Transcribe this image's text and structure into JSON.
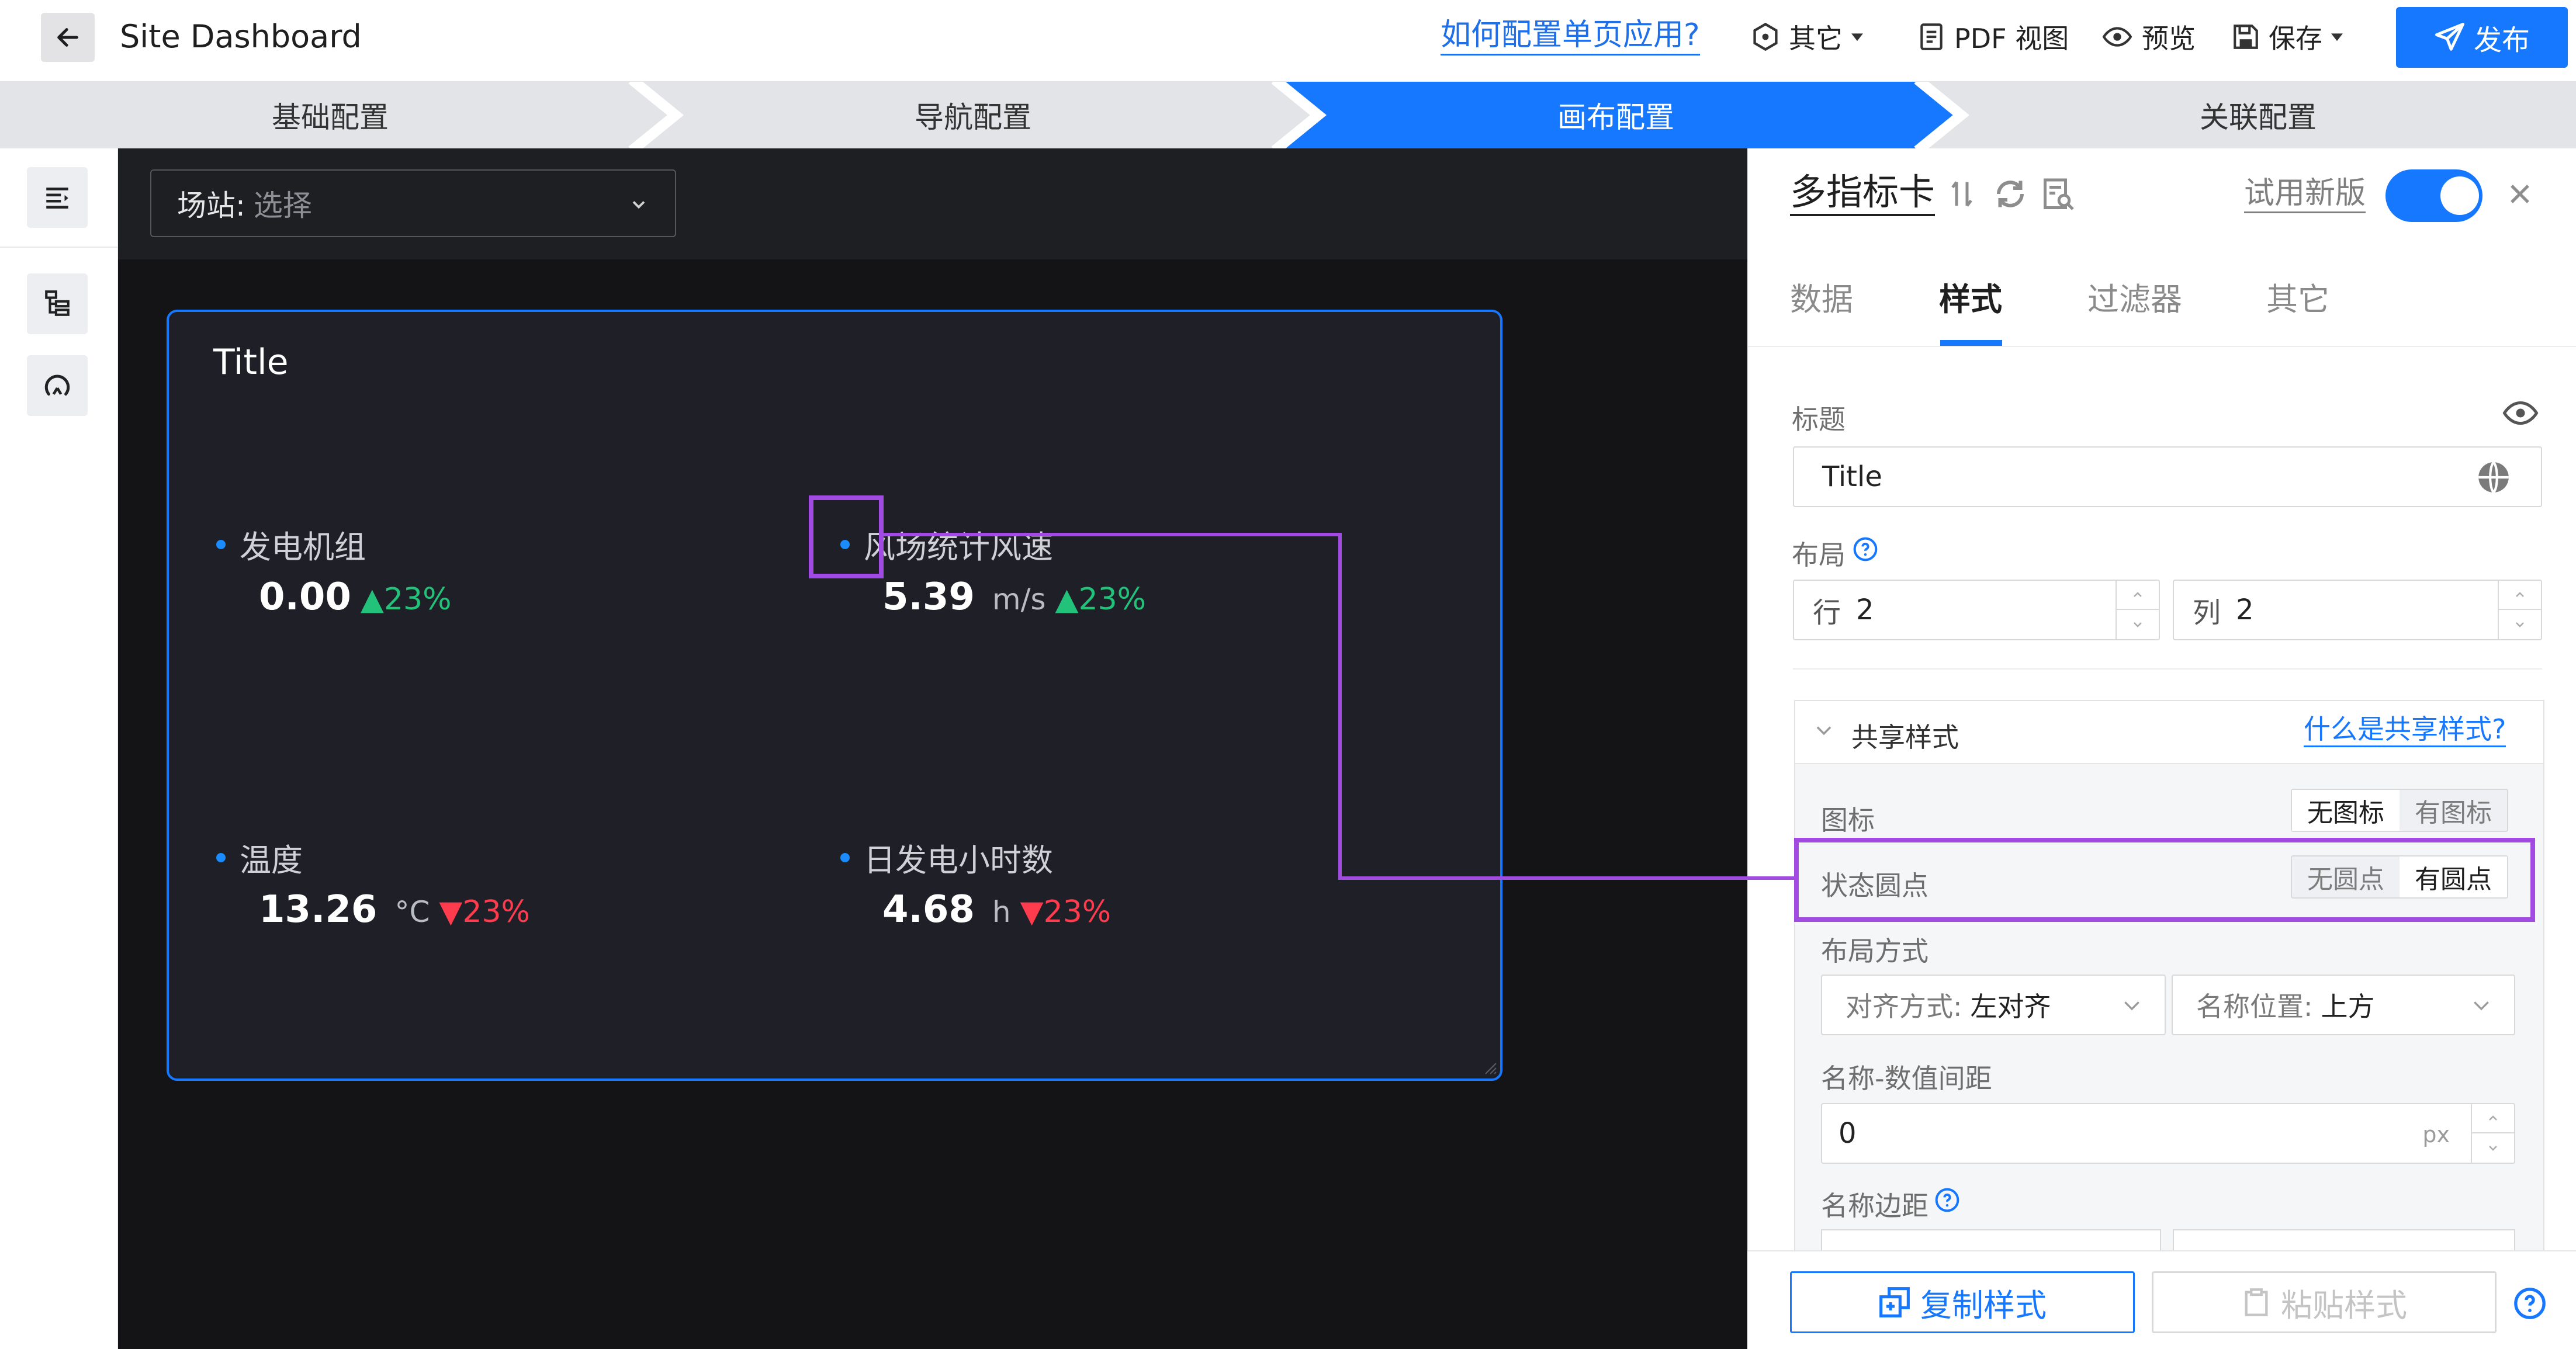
{
  "header": {
    "title": "Site Dashboard",
    "help_link": "如何配置单页应用?",
    "toolbar": {
      "other": "其它",
      "pdf_view": "PDF 视图",
      "preview": "预览",
      "save": "保存",
      "publish": "发布"
    }
  },
  "steps": [
    {
      "label": "基础配置",
      "active": false
    },
    {
      "label": "导航配置",
      "active": false
    },
    {
      "label": "画布配置",
      "active": true
    },
    {
      "label": "关联配置",
      "active": false
    }
  ],
  "canvas": {
    "site_select": {
      "label": "场站:",
      "placeholder": "选择"
    },
    "card": {
      "title": "Title",
      "metrics": [
        {
          "name": "发电机组",
          "value": "0.00",
          "unit": "",
          "trend": "up",
          "change": "23%"
        },
        {
          "name": "风场统计风速",
          "value": "5.39",
          "unit": "m/s",
          "trend": "up",
          "change": "23%"
        },
        {
          "name": "温度",
          "value": "13.26",
          "unit": "°C",
          "trend": "down",
          "change": "23%"
        },
        {
          "name": "日发电小时数",
          "value": "4.68",
          "unit": "h",
          "trend": "down",
          "change": "23%"
        }
      ]
    }
  },
  "panel": {
    "title": "多指标卡",
    "try_new": "试用新版",
    "toggle_on": true,
    "tabs": [
      {
        "label": "数据",
        "active": false
      },
      {
        "label": "样式",
        "active": true
      },
      {
        "label": "过滤器",
        "active": false
      },
      {
        "label": "其它",
        "active": false
      }
    ],
    "title_section": {
      "label": "标题",
      "value": "Title"
    },
    "layout": {
      "label": "布局",
      "row_label": "行",
      "row_value": "2",
      "col_label": "列",
      "col_value": "2"
    },
    "shared_style": {
      "title": "共享样式",
      "help_link": "什么是共享样式?",
      "icon": {
        "label": "图标",
        "options": [
          "无图标",
          "有图标"
        ],
        "selected": "无图标"
      },
      "status_dot": {
        "label": "状态圆点",
        "options": [
          "无圆点",
          "有圆点"
        ],
        "selected": "有圆点"
      },
      "layout_mode": {
        "label": "布局方式",
        "align_key": "对齐方式:",
        "align_value": "左对齐",
        "name_pos_key": "名称位置:",
        "name_pos_value": "上方"
      },
      "name_value_gap": {
        "label": "名称-数值间距",
        "value": "0",
        "unit": "px"
      },
      "name_margin": {
        "label": "名称边距"
      }
    },
    "footer": {
      "copy_style": "复制样式",
      "paste_style": "粘贴样式"
    }
  },
  "colors": {
    "accent": "#1677ff",
    "up": "#22c27a",
    "down": "#ff3b4e",
    "annotation": "#a14be3",
    "canvas_bg": "#141416"
  }
}
